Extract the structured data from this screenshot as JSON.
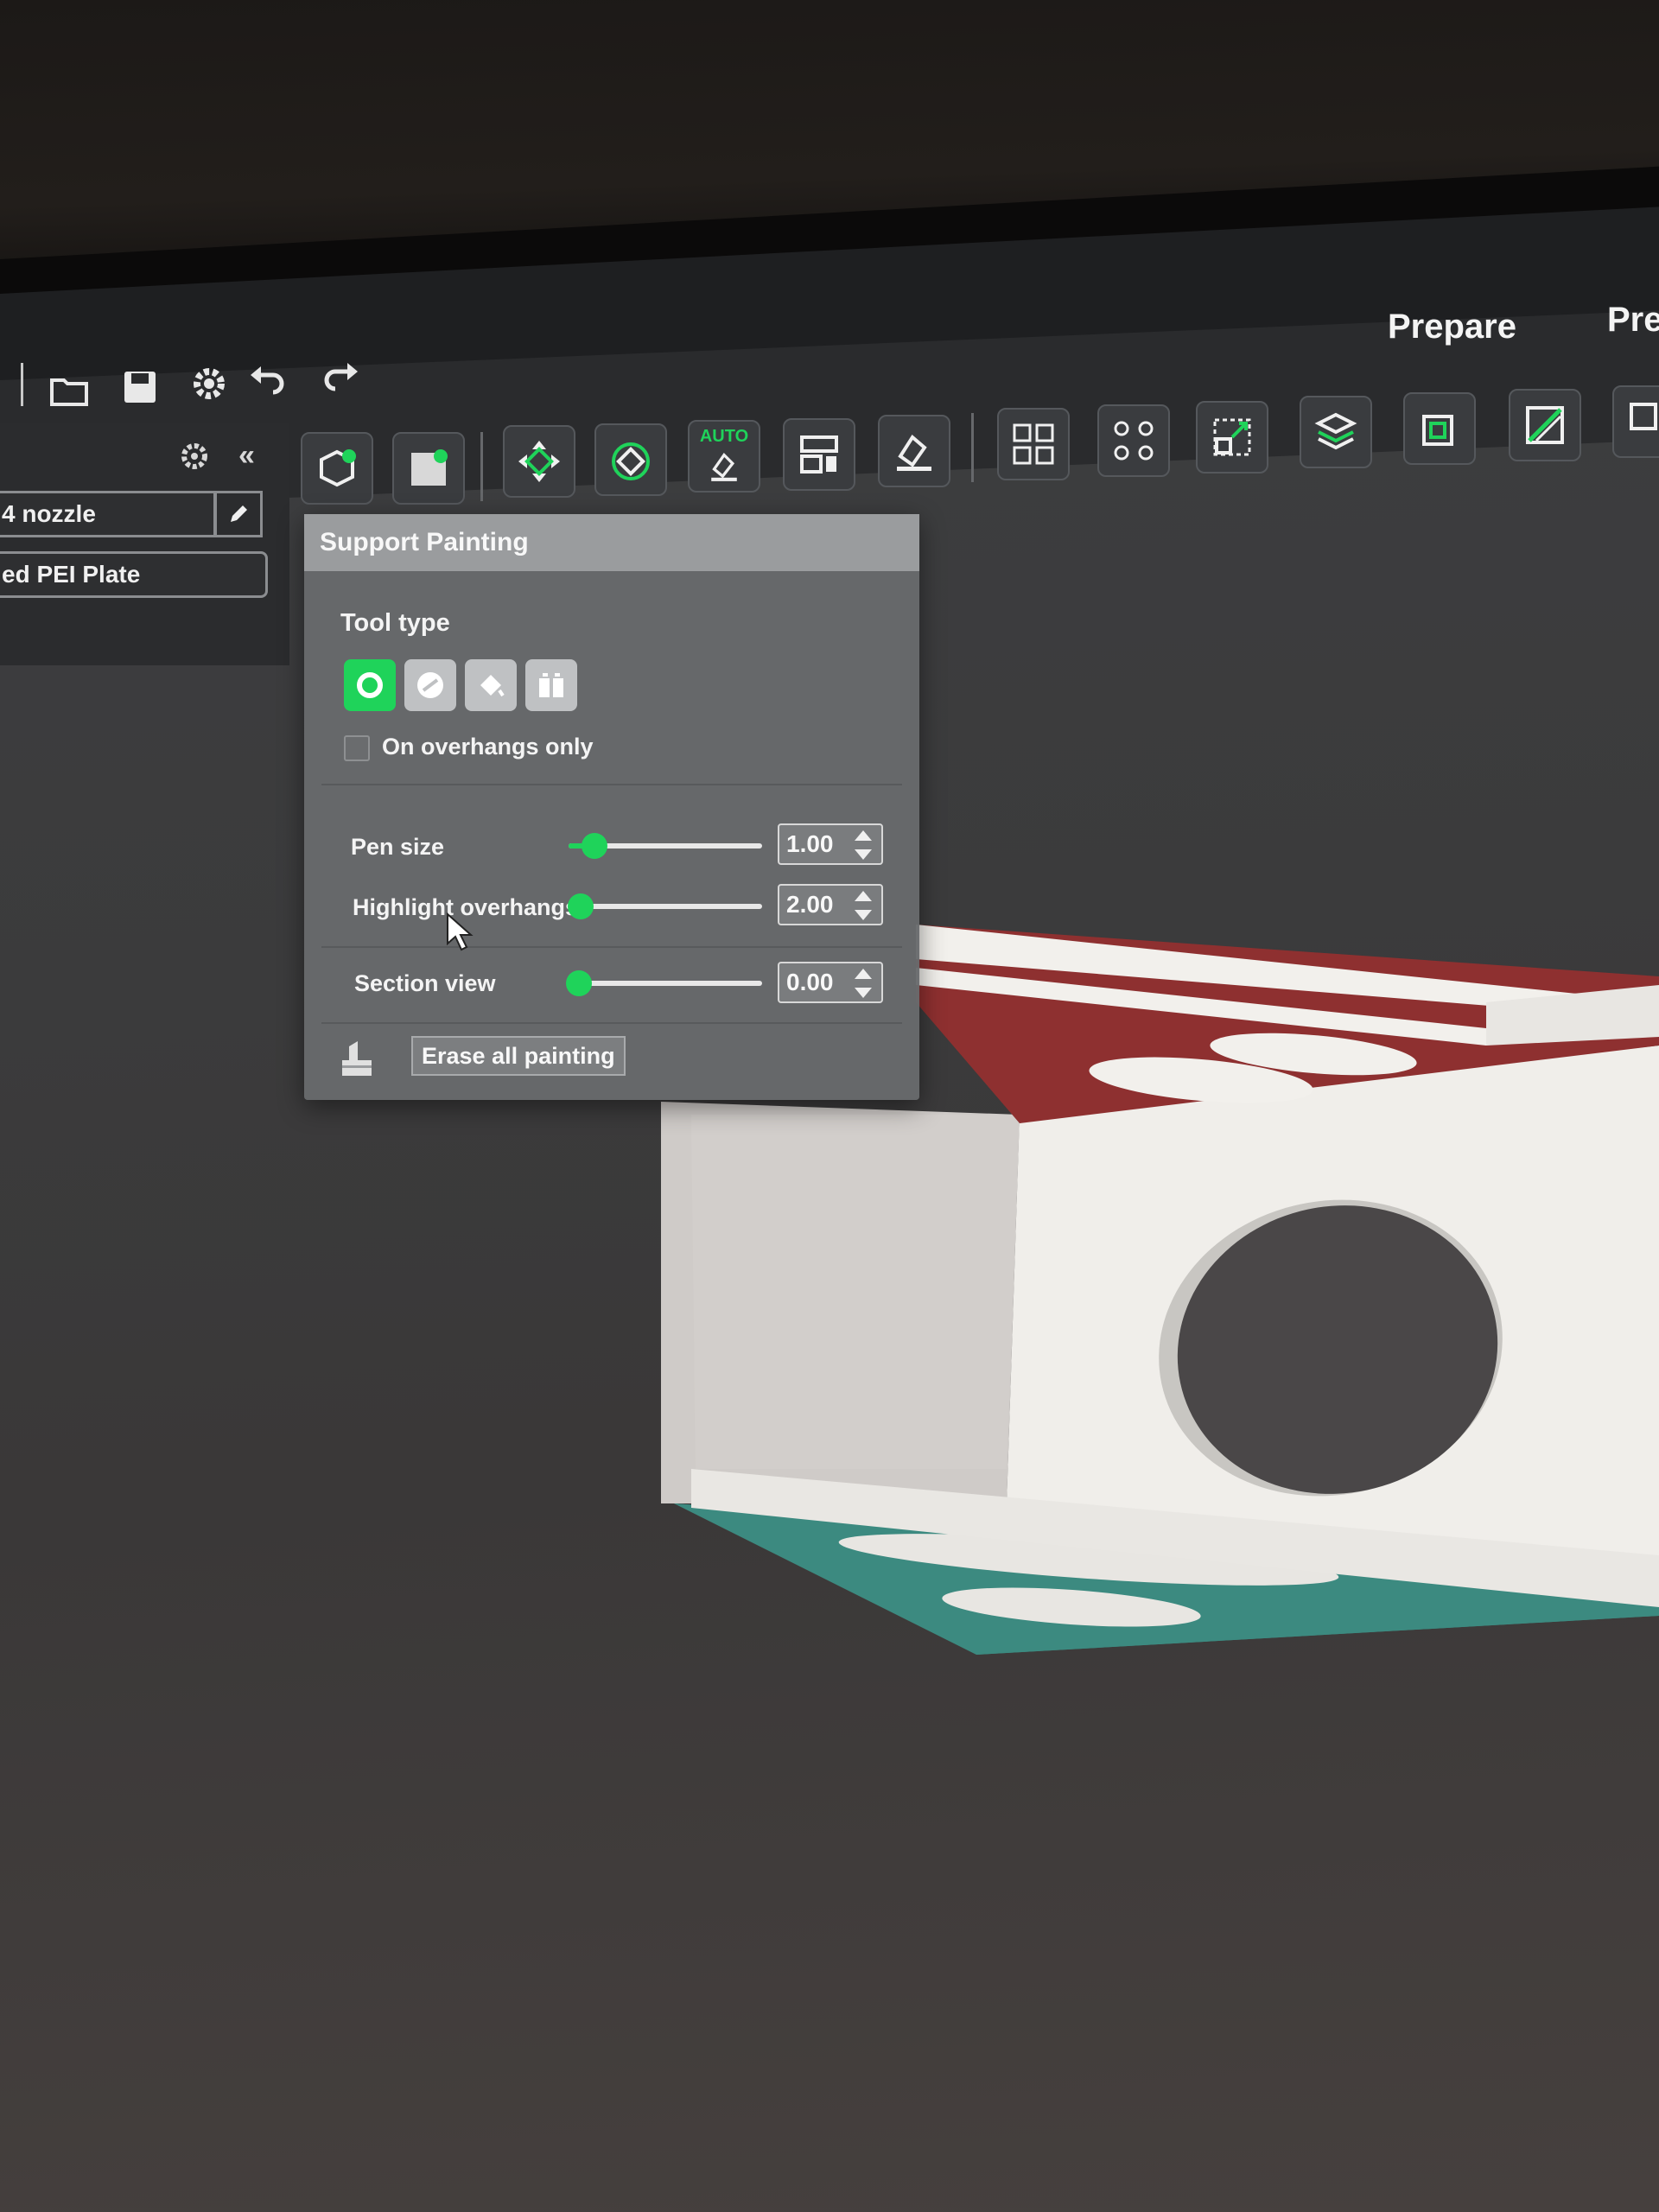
{
  "header": {
    "tabs": [
      {
        "label": "Prepare"
      },
      {
        "label": "Pre"
      }
    ]
  },
  "quick_toolbar": {
    "icons": [
      "open-folder-icon",
      "save-icon",
      "gear-icon",
      "undo-icon",
      "redo-icon"
    ]
  },
  "sidebar": {
    "nozzle": "4 nozzle",
    "plate": "ed PEI Plate"
  },
  "toolbar": {
    "auto_badge": "AUTO"
  },
  "panel": {
    "title": "Support Painting",
    "tool_type_label": "Tool type",
    "overhangs_only_label": "On overhangs only",
    "overhangs_only_checked": false,
    "pen_size": {
      "label": "Pen size",
      "value": "1.00"
    },
    "highlight_overhangs": {
      "label": "Highlight overhangs",
      "value": "2.00"
    },
    "section_view": {
      "label": "Section view",
      "value": "0.00"
    },
    "erase_label": "Erase all painting"
  },
  "colors": {
    "accent": "#1fd35a",
    "paint_red": "#8e3030",
    "bed_teal": "#3c8a80"
  }
}
